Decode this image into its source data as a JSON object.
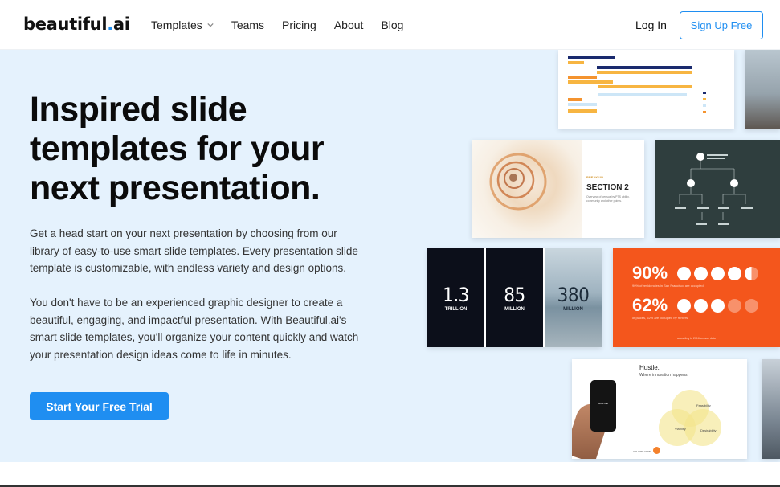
{
  "header": {
    "logo_text": "beautiful",
    "logo_dot": ".",
    "logo_suffix": "ai",
    "nav": [
      {
        "label": "Templates",
        "has_dropdown": true
      },
      {
        "label": "Teams"
      },
      {
        "label": "Pricing"
      },
      {
        "label": "About"
      },
      {
        "label": "Blog"
      }
    ],
    "login_label": "Log In",
    "signup_label": "Sign Up Free"
  },
  "hero": {
    "title": "Inspired slide templates for your next presentation.",
    "paragraph1": "Get a head start on your next presentation by choosing from our library of easy-to-use smart slide templates. Every presentation slide template is customizable, with endless variety and design options.",
    "paragraph2": "You don't have to be an experienced graphic designer to create a beautiful, engaging, and impactful presentation. With Beautiful.ai's smart slide templates, you'll organize your content quickly and watch your presentation design ideas come to life in minutes.",
    "cta_label": "Start Your Free Trial"
  },
  "slides": {
    "section": {
      "kicker": "BREAK UP",
      "title": "SECTION 2",
      "subtitle": "Overview of census by PTS ability, community and other points."
    },
    "numbers": [
      {
        "value": "1.3",
        "unit": "TRILLION"
      },
      {
        "value": "85",
        "unit": "MILLION"
      },
      {
        "value": "380",
        "unit": "MILLION"
      }
    ],
    "percent": [
      {
        "value": "90%",
        "caption": "90% of residencies in San Francisco are occupied",
        "filled": 4.5
      },
      {
        "value": "62%",
        "caption": "of places, 62% are occupied by renters",
        "filled": 3
      }
    ],
    "percent_footer": "according to 2016 census data",
    "hustle": {
      "title": "Hustle.",
      "subtitle": "Where innovation happens.",
      "phone_text": "HUSTLE",
      "marker_label": "YOU ARE HERE",
      "venn": [
        "Feasibility",
        "Viability",
        "Desirability"
      ]
    }
  },
  "colors": {
    "accent": "#1f8ef1",
    "hero_bg": "#e5f2fd",
    "orange": "#f4561c",
    "dark_slate": "#2f3e3e"
  }
}
